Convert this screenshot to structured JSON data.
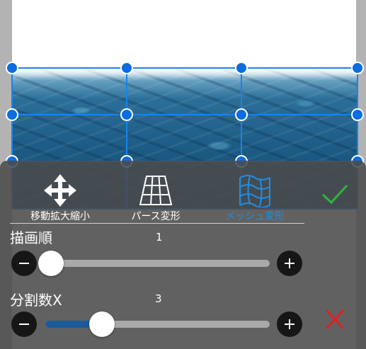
{
  "tools": [
    {
      "id": "move",
      "label": "移動拡大縮小",
      "icon": "move-arrows-icon",
      "active": false
    },
    {
      "id": "perspective",
      "label": "パース変形",
      "icon": "perspective-grid-icon",
      "active": false
    },
    {
      "id": "mesh",
      "label": "メッシュ変形",
      "icon": "mesh-warp-icon",
      "active": true
    }
  ],
  "confirm": {
    "icon": "checkmark-icon",
    "color": "#2fb53a"
  },
  "cancel": {
    "icon": "close-x-icon",
    "color": "#e02020"
  },
  "sliders": {
    "order": {
      "label": "描画順",
      "value": "1",
      "level": 0.0
    },
    "split_x": {
      "label": "分割数X",
      "value": "3",
      "level": 0.25
    }
  },
  "colors": {
    "accent": "#1e8fe6",
    "mesh_line": "#1585f0",
    "handle": "#0a6de0",
    "slider_fill": "#1a5b9a"
  }
}
